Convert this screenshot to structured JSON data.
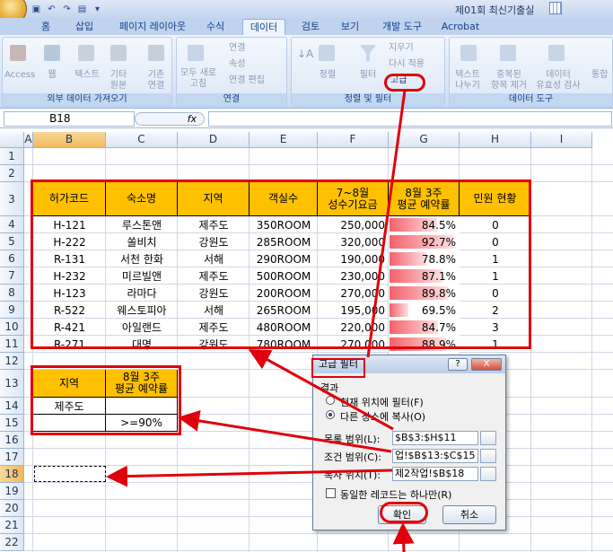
{
  "window": {
    "title": "제01회 최신기출실",
    "office_button": "office-logo",
    "qat_icons": [
      "save-icon",
      "undo-icon",
      "redo-icon",
      "print-icon",
      "more-icon"
    ]
  },
  "tabs": [
    "홈",
    "삽입",
    "페이지 레이아웃",
    "수식",
    "데이터",
    "검토",
    "보기",
    "개발 도구",
    "Acrobat"
  ],
  "active_tab": "데이터",
  "ribbon": {
    "ext": {
      "items": [
        "Access",
        "웹",
        "텍스트",
        "기타\n원본",
        "기존\n연결"
      ],
      "label": "외부 데이터 가져오기"
    },
    "conn": {
      "refresh": "모두 새로\n고침",
      "items": [
        "연결",
        "속성",
        "연결 편집"
      ],
      "label": "연결"
    },
    "sort": {
      "sort": "정렬",
      "filter": "필터",
      "clear": "지우기",
      "reapply": "다시 적용",
      "advanced": "고급",
      "label": "정렬 및 필터"
    },
    "tools": {
      "text_to_col": "텍스트\n나누기",
      "remove_dup": "중복된\n항목 제거",
      "validation": "데이터\n유효성 검사",
      "consolidate": "통합",
      "label": "데이터 도구"
    }
  },
  "name_box": "B18",
  "fx": "fx",
  "columns": [
    "A",
    "B",
    "C",
    "D",
    "E",
    "F",
    "G",
    "H",
    "I"
  ],
  "rows": [
    "1",
    "2",
    "3",
    "4",
    "5",
    "6",
    "7",
    "8",
    "9",
    "10",
    "11",
    "12",
    "13",
    "14",
    "15",
    "16",
    "17",
    "18",
    "19",
    "20",
    "21",
    "22"
  ],
  "table": {
    "headers": [
      "허가코드",
      "숙소명",
      "지역",
      "객실수",
      "7~8월\n성수기요금",
      "8월 3주\n평균 예약률",
      "민원 현황"
    ],
    "rows": [
      [
        "H-121",
        "루스톤앤",
        "제주도",
        "350ROOM",
        "250,000",
        "84.5%",
        "0"
      ],
      [
        "H-222",
        "쏠비치",
        "강원도",
        "285ROOM",
        "320,000",
        "92.7%",
        "0"
      ],
      [
        "R-131",
        "서천 한화",
        "서해",
        "290ROOM",
        "190,000",
        "78.8%",
        "1"
      ],
      [
        "H-232",
        "미르빌앤",
        "제주도",
        "500ROOM",
        "230,000",
        "87.1%",
        "1"
      ],
      [
        "H-123",
        "라마다",
        "강원도",
        "200ROOM",
        "270,000",
        "89.8%",
        "0"
      ],
      [
        "R-522",
        "웨스토피아",
        "서해",
        "265ROOM",
        "195,000",
        "69.5%",
        "2"
      ],
      [
        "R-421",
        "아일랜드",
        "제주도",
        "480ROOM",
        "220,000",
        "84.7%",
        "3"
      ],
      [
        "R-271",
        "대명",
        "강원도",
        "780ROOM",
        "270,000",
        "88.9%",
        "1"
      ]
    ],
    "rate_values": [
      0.845,
      0.927,
      0.788,
      0.871,
      0.898,
      0.695,
      0.847,
      0.889
    ]
  },
  "criteria": {
    "headers": [
      "지역",
      "8월 3주\n평균 예약률"
    ],
    "row1": [
      "제주도",
      ""
    ],
    "row2": [
      "",
      ">=90%"
    ]
  },
  "dialog": {
    "title": "고급 필터",
    "help": "?",
    "close": "X",
    "section": "결과",
    "opt1": "현재 위치에 필터(F)",
    "opt2": "다른 장소에 복사(O)",
    "list_label": "목록 범위(L):",
    "list_value": "$B$3:$H$11",
    "crit_label": "조건 범위(C):",
    "crit_value": "업!$B$13:$C$15",
    "copy_label": "복사 위치(T):",
    "copy_value": "제2작업!$B$18",
    "unique": "동일한 레코드는 하나만(R)",
    "ok": "확인",
    "cancel": "취소"
  },
  "colors": {
    "accent": "#e0000b",
    "header_fill": "#ffc000",
    "databar": "#f4606a"
  }
}
